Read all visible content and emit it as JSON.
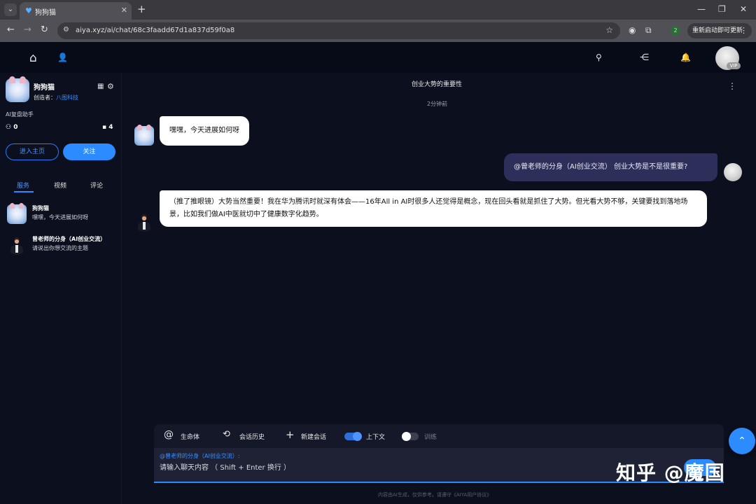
{
  "browser": {
    "tab_title": "狗狗猫",
    "tab_close": "✕",
    "new_tab": "+",
    "url": "aiya.xyz/ai/chat/68c3faadd67d1a837d59f0a8",
    "update_label": "重新启动即可更新",
    "profile_number": "2"
  },
  "topbar": {
    "vip_label": "VIP"
  },
  "sidebar": {
    "bot_name": "狗狗猫",
    "creator_label": "创造者：",
    "creator_name": "八图科技",
    "description": "AI复盘助手",
    "followers": "0",
    "messages": "4",
    "home_button": "进入主页",
    "follow_button": "关注",
    "tabs": [
      {
        "label": "服务"
      },
      {
        "label": "视频"
      },
      {
        "label": "评论"
      }
    ],
    "services": [
      {
        "title": "狗狗猫",
        "subtitle": "嘿嘿，今天进展如何呀"
      },
      {
        "title": "曾老师的分身（AI创业交流）",
        "subtitle": "请说出你想交流的主题"
      }
    ]
  },
  "chat": {
    "title": "创业大势的重要性",
    "time": "2分钟前",
    "messages": [
      {
        "from": "bot",
        "text": "嘿嘿，今天进展如何呀"
      },
      {
        "from": "user",
        "text": "@曾老师的分身（AI创业交流） 创业大势是不是很重要?"
      },
      {
        "from": "mentor",
        "text": "（推了推眼镜）大势当然重要！我在华为腾讯时就深有体会——16年All in AI时很多人还觉得是概念，现在回头看就是抓住了大势。但光看大势不够，关键要找到落地场景，比如我们做AI中医就切中了健康数字化趋势。"
      }
    ]
  },
  "composer": {
    "tool_life": "生命体",
    "tool_history": "会话历史",
    "tool_new": "新建会话",
    "tool_context": "上下文",
    "tool_train": "训练",
    "context_on": true,
    "train_on": false,
    "mention": "@曾老师的分身（AI创业交流）:",
    "placeholder": "请输入聊天内容 （ Shift + Enter 换行 ）",
    "footer": "内容由AI生成，仅供参考。请遵守《AIYA用户协议》"
  },
  "watermark": "知乎 @魔国",
  "colors": {
    "accent": "#2c8bff",
    "background": "#0b0f1e",
    "user_bubble": "#2d2f5a",
    "bot_bubble": "#ffffff"
  }
}
